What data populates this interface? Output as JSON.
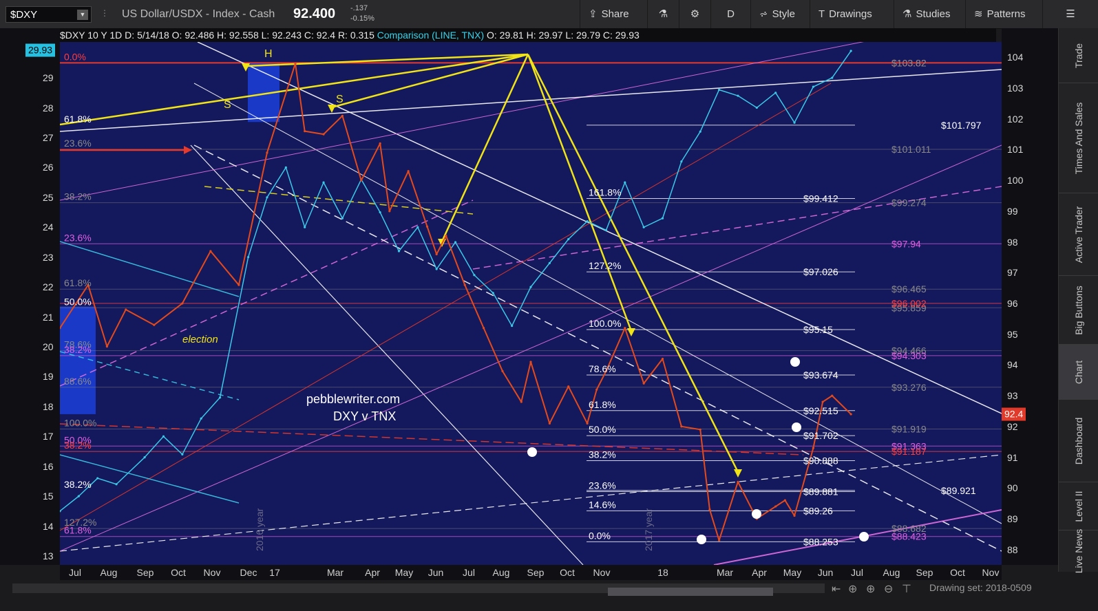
{
  "toolbar": {
    "symbol": "$DXY",
    "description": "US Dollar/USDX - Index - Cash",
    "last": "92.400",
    "change": "-.137",
    "change_pct": "-0.15%",
    "share": "Share",
    "flask": "",
    "gear": "",
    "period": "D",
    "style": "Style",
    "drawings": "Drawings",
    "studies": "Studies",
    "patterns": "Patterns"
  },
  "infobar": {
    "main": "$DXY 10 Y 1D  D: 5/14/18  O: 92.486  H: 92.558  L: 92.243  C: 92.4  R: 0.315",
    "comparison": "Comparison (LINE, TNX)",
    "comparison_values": "O: 29.81  H: 29.97  L: 29.79  C: 29.93"
  },
  "side_tabs": [
    "Trade",
    "Times And Sales",
    "Active Trader",
    "Big Buttons",
    "Chart",
    "Dashboard",
    "Level II",
    "Live News"
  ],
  "bottom": {
    "drawing_set": "Drawing set: 2018-0509"
  },
  "colors": {
    "plot_bg": "#14185c",
    "price_up": "#2fbf3a",
    "price_down": "#e34a1c",
    "comparison": "#3cc8e6",
    "arrow_yellow": "#f0e418",
    "fib_magenta": "#e070e0",
    "red_line": "#e83a2a"
  },
  "chart_data": {
    "type": "line",
    "title": "",
    "watermark": [
      "pebblewriter.com",
      "DXY v TNX"
    ],
    "right_axis": {
      "ticks": [
        "104",
        "103",
        "102",
        "101",
        "100",
        "99",
        "98",
        "97",
        "96",
        "95",
        "94",
        "93",
        "92",
        "91",
        "90",
        "89",
        "88"
      ],
      "range": [
        87.5,
        104.5
      ]
    },
    "left_axis": {
      "ticks": [
        "29",
        "28",
        "27",
        "26",
        "25",
        "24",
        "23",
        "22",
        "21",
        "20",
        "19",
        "18",
        "17",
        "16",
        "15",
        "14",
        "13"
      ],
      "current": "29.93"
    },
    "x_ticks": [
      "Jul",
      "Aug",
      "Sep",
      "Oct",
      "Nov",
      "Dec",
      "17",
      "Mar",
      "Apr",
      "May",
      "Jun",
      "Jul",
      "Aug",
      "Sep",
      "Oct",
      "Nov",
      "18",
      "Mar",
      "Apr",
      "May",
      "Jun",
      "Jul",
      "Aug",
      "Sep",
      "Oct",
      "Nov"
    ],
    "current_price": "92.4",
    "price_labels": [
      {
        "label": "$103.82",
        "value": 103.82,
        "color": "#ff4040"
      },
      {
        "label": "$103.82",
        "value": 103.82,
        "color": "#8a8a8a"
      },
      {
        "label": "$101.797",
        "value": 101.797,
        "color": "#ffffff"
      },
      {
        "label": "$101.011",
        "value": 101.011,
        "color": "#8a8a8a"
      },
      {
        "label": "$99.412",
        "value": 99.412,
        "color": "#ffffff"
      },
      {
        "label": "$99.274",
        "value": 99.274,
        "color": "#8a8a8a"
      },
      {
        "label": "$97.94",
        "value": 97.94,
        "color": "#e060e0"
      },
      {
        "label": "$97.026",
        "value": 97.026,
        "color": "#ffffff"
      },
      {
        "label": "$96.465",
        "value": 96.465,
        "color": "#8a8a8a"
      },
      {
        "label": "$95.859",
        "value": 95.859,
        "color": "#8a8a8a"
      },
      {
        "label": "$96.002",
        "value": 96.002,
        "color": "#ff4040"
      },
      {
        "label": "$95.15",
        "value": 95.15,
        "color": "#ffffff"
      },
      {
        "label": "$94.466",
        "value": 94.466,
        "color": "#8a8a8a"
      },
      {
        "label": "$94.303",
        "value": 94.303,
        "color": "#e060e0"
      },
      {
        "label": "$93.674",
        "value": 93.674,
        "color": "#ffffff"
      },
      {
        "label": "$93.276",
        "value": 93.276,
        "color": "#8a8a8a"
      },
      {
        "label": "$92.515",
        "value": 92.515,
        "color": "#ffffff"
      },
      {
        "label": "$91.919",
        "value": 91.919,
        "color": "#8a8a8a"
      },
      {
        "label": "$91.702",
        "value": 91.702,
        "color": "#ffffff"
      },
      {
        "label": "$91.363",
        "value": 91.363,
        "color": "#e060e0"
      },
      {
        "label": "$91.187",
        "value": 91.187,
        "color": "#ff4040"
      },
      {
        "label": "$90.888",
        "value": 90.888,
        "color": "#ffffff"
      },
      {
        "label": "$89.921",
        "value": 89.921,
        "color": "#ffffff"
      },
      {
        "label": "$89.881",
        "value": 89.881,
        "color": "#ffffff"
      },
      {
        "label": "$89.26",
        "value": 89.26,
        "color": "#ffffff"
      },
      {
        "label": "$88.682",
        "value": 88.682,
        "color": "#8a8a8a"
      },
      {
        "label": "$88.423",
        "value": 88.423,
        "color": "#e060e0"
      },
      {
        "label": "$88.253",
        "value": 88.253,
        "color": "#ffffff"
      }
    ],
    "fib_labels": [
      {
        "label": "161.8%",
        "value": 99.412
      },
      {
        "label": "127.2%",
        "value": 97.026
      },
      {
        "label": "100.0%",
        "value": 95.15
      },
      {
        "label": "78.6%",
        "value": 93.674
      },
      {
        "label": "61.8%",
        "value": 92.515
      },
      {
        "label": "50.0%",
        "value": 91.702
      },
      {
        "label": "38.2%",
        "value": 90.888
      },
      {
        "label": "23.6%",
        "value": 89.881
      },
      {
        "label": "14.6%",
        "value": 89.26
      },
      {
        "label": "0.0%",
        "value": 88.253
      }
    ],
    "left_fib_labels": [
      {
        "label": "0.0%",
        "value": 103.82,
        "color": "#ff4040"
      },
      {
        "label": "61.8%",
        "value": 101.797,
        "color": "#ffffff"
      },
      {
        "label": "23.6%",
        "value": 101.011,
        "color": "#8a8a8a"
      },
      {
        "label": "38.2%",
        "value": 99.274,
        "color": "#8a8a8a"
      },
      {
        "label": "23.6%",
        "value": 97.94,
        "color": "#e060e0"
      },
      {
        "label": "61.8%",
        "value": 96.465,
        "color": "#8a8a8a"
      },
      {
        "label": "50.0%",
        "value": 95.859,
        "color": "#ffffff"
      },
      {
        "label": "78.6%",
        "value": 94.466,
        "color": "#8a8a8a"
      },
      {
        "label": "38.2%",
        "value": 94.303,
        "color": "#e060e0"
      },
      {
        "label": "88.6%",
        "value": 93.276,
        "color": "#8a8a8a"
      },
      {
        "label": "100.0%",
        "value": 91.919,
        "color": "#8a8a8a"
      },
      {
        "label": "50.0%",
        "value": 91.363,
        "color": "#e060e0"
      },
      {
        "label": "38.2%",
        "value": 91.187,
        "color": "#ff4040"
      },
      {
        "label": "38.2%",
        "value": 89.921,
        "color": "#ffffff"
      },
      {
        "label": "127.2%",
        "value": 88.682,
        "color": "#8a8a8a"
      },
      {
        "label": "61.8%",
        "value": 88.423,
        "color": "#e060e0"
      }
    ],
    "annotations": [
      "H",
      "S",
      "S",
      "election",
      "2016 year",
      "2017 year"
    ],
    "dxy_series": {
      "name": "$DXY",
      "x": [
        0,
        0.03,
        0.05,
        0.07,
        0.1,
        0.13,
        0.16,
        0.19,
        0.22,
        0.25,
        0.26,
        0.28,
        0.3,
        0.32,
        0.34,
        0.35,
        0.37,
        0.39,
        0.4,
        0.41,
        0.43,
        0.45,
        0.47,
        0.49,
        0.5,
        0.52,
        0.54,
        0.56,
        0.57,
        0.58,
        0.6,
        0.62,
        0.64,
        0.66,
        0.68,
        0.69,
        0.7,
        0.72,
        0.74,
        0.76,
        0.77,
        0.78,
        0.8,
        0.81,
        0.82,
        0.84
      ],
      "values": [
        95.2,
        96.6,
        94.6,
        95.8,
        95.3,
        96.0,
        97.7,
        96.6,
        100.9,
        103.8,
        101.6,
        101.5,
        102.1,
        100.0,
        101.2,
        99.0,
        100.3,
        98.5,
        97.6,
        98.2,
        96.6,
        95.2,
        93.8,
        92.8,
        94.1,
        92.1,
        93.3,
        92.1,
        93.2,
        93.8,
        95.2,
        93.4,
        94.2,
        92.0,
        91.9,
        89.3,
        88.3,
        90.2,
        89.0,
        89.4,
        89.6,
        89.1,
        91.3,
        92.8,
        93.0,
        92.4
      ]
    },
    "tnx_series": {
      "name": "TNX",
      "x": [
        0,
        0.02,
        0.04,
        0.06,
        0.09,
        0.11,
        0.13,
        0.15,
        0.17,
        0.2,
        0.22,
        0.24,
        0.26,
        0.28,
        0.3,
        0.32,
        0.34,
        0.36,
        0.38,
        0.4,
        0.42,
        0.44,
        0.46,
        0.48,
        0.5,
        0.52,
        0.54,
        0.56,
        0.58,
        0.6,
        0.62,
        0.64,
        0.66,
        0.68,
        0.7,
        0.72,
        0.74,
        0.76,
        0.78,
        0.8,
        0.82,
        0.84
      ],
      "values": [
        14.5,
        15.0,
        15.6,
        15.4,
        16.3,
        17.0,
        16.4,
        17.6,
        18.3,
        23.0,
        25.0,
        26.0,
        24.0,
        25.5,
        24.3,
        25.6,
        24.5,
        23.2,
        24.0,
        22.6,
        23.5,
        22.4,
        21.8,
        20.7,
        22.0,
        22.8,
        23.6,
        24.2,
        23.9,
        25.5,
        24.0,
        24.3,
        26.2,
        27.2,
        28.6,
        28.4,
        28.0,
        28.5,
        27.5,
        28.7,
        29.0,
        29.9
      ]
    }
  }
}
